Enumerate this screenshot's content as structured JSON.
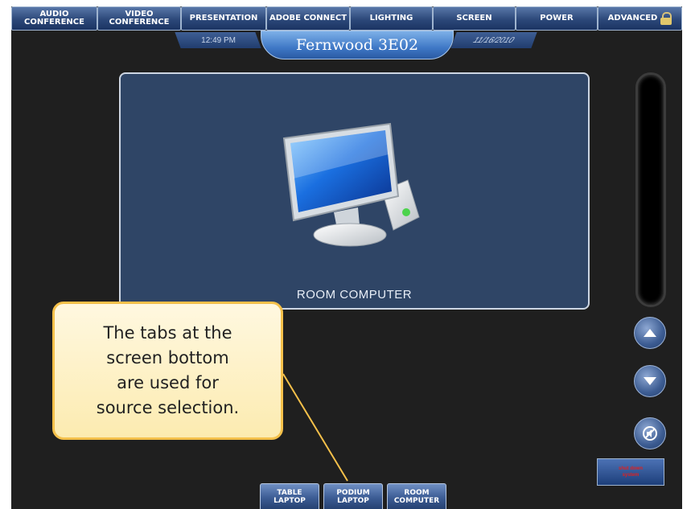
{
  "nav": {
    "tabs": [
      {
        "label": "AUDIO\nCONFERENCE"
      },
      {
        "label": "VIDEO\nCONFERENCE"
      },
      {
        "label": "PRESENTATION"
      },
      {
        "label": "ADOBE CONNECT"
      },
      {
        "label": "LIGHTING"
      },
      {
        "label": "SCREEN"
      },
      {
        "label": "POWER"
      },
      {
        "label": "ADVANCED"
      }
    ],
    "advanced_icon": "lock-icon"
  },
  "status": {
    "time": "12:49 PM",
    "room": "Fernwood 3E02",
    "date": "11/16/2010"
  },
  "panel": {
    "label": "ROOM COMPUTER",
    "icon": "computer-icon"
  },
  "side_controls": {
    "up_icon": "volume-up-icon",
    "down_icon": "volume-down-icon",
    "mute_icon": "mute-icon",
    "system_button": "shut down\nsystem"
  },
  "sources": [
    {
      "label": "TABLE\nLAPTOP"
    },
    {
      "label": "PODIUM\nLAPTOP"
    },
    {
      "label": "ROOM\nCOMPUTER"
    }
  ],
  "callout": {
    "text": "The tabs at the\nscreen bottom\nare used for\nsource selection."
  },
  "colors": {
    "background": "#1f1f1f",
    "tab_blue": "#2c4879",
    "panel_blue": "#2f4566",
    "callout_fill": "#fcebb0",
    "callout_border": "#f4c04a",
    "system_text": "#e02020"
  }
}
